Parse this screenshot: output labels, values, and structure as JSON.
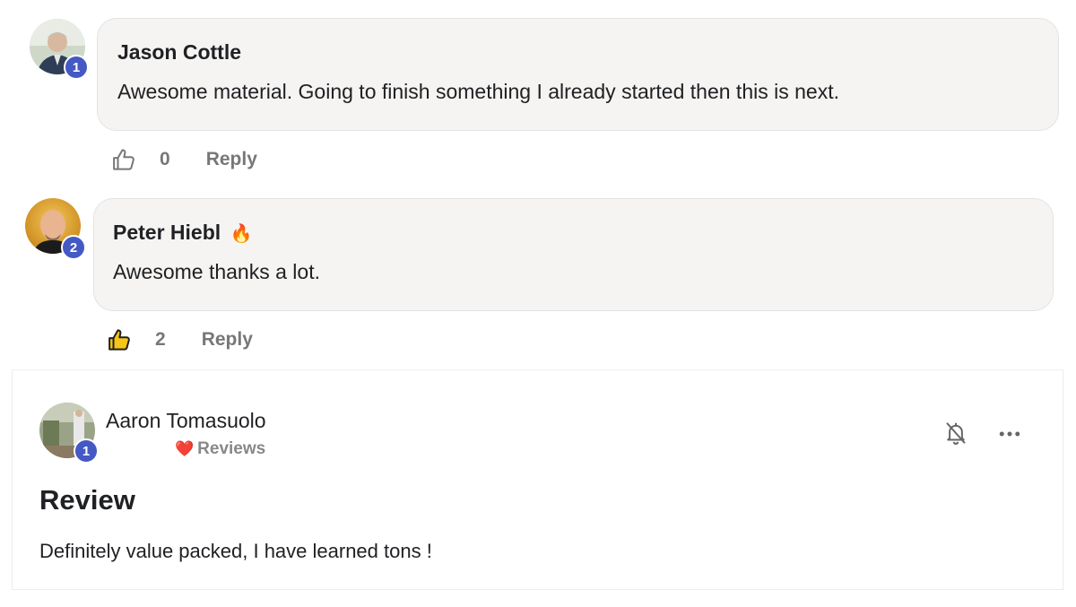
{
  "comments": [
    {
      "author": "Jason Cottle",
      "level": "1",
      "text": "Awesome material. Going to finish something I already started then this is next.",
      "like_count": "0",
      "liked": false,
      "reply_label": "Reply"
    },
    {
      "author": "Peter Hiebl",
      "author_emoji": "🔥",
      "level": "2",
      "text": "Awesome thanks a lot.",
      "like_count": "2",
      "liked": true,
      "reply_label": "Reply"
    }
  ],
  "post": {
    "author": "Aaron Tomasuolo",
    "level": "1",
    "category_emoji": "❤️",
    "category": "Reviews",
    "title": "Review",
    "body": "Definitely value packed, I have learned tons !"
  },
  "icons": {
    "like": "thumbs-up-icon",
    "bell": "bell-off-icon",
    "more": "more-horizontal-icon"
  },
  "colors": {
    "level_badge": "#4459c4",
    "liked_thumb": "#f5c518",
    "bubble_bg": "#f5f4f2",
    "muted_text": "#777777"
  }
}
